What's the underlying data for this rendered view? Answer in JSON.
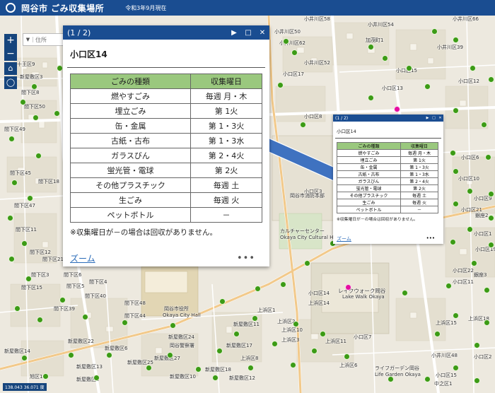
{
  "header": {
    "title": "岡谷市 ごみ収集場所",
    "date": "令和3年9月現在"
  },
  "search": {
    "placeholder": "住所"
  },
  "coords": "138.043 36.071 度",
  "popup": {
    "count": "(1 / 2)",
    "title": "小口区14",
    "columns": [
      "ごみの種類",
      "収集曜日"
    ],
    "rows": [
      [
        "燃やすごみ",
        "毎週 月・木"
      ],
      [
        "埋立ごみ",
        "第 1火"
      ],
      [
        "缶・金属",
        "第 1・3火"
      ],
      [
        "古紙・古布",
        "第 1・3水"
      ],
      [
        "ガラスびん",
        "第 2・4火"
      ],
      [
        "蛍光管・電球",
        "第 2火"
      ],
      [
        "その他プラスチック",
        "毎週 土"
      ],
      [
        "生ごみ",
        "毎週 火"
      ],
      [
        "ペットボトル",
        "－"
      ]
    ],
    "note": "※収集曜日が－の場合は回収がありません。",
    "zoom_label": "ズーム",
    "more_label": "•••"
  },
  "small_popup": {
    "count": "(1 / 2)",
    "title": "小口区14",
    "columns": [
      "ごみの種類",
      "収集曜日"
    ],
    "rows": [
      [
        "燃やすごみ",
        "毎週 月・木"
      ],
      [
        "埋立ごみ",
        "第 1火"
      ],
      [
        "缶・金属",
        "第 1・3火"
      ],
      [
        "古紙・古布",
        "第 1・3水"
      ],
      [
        "ガラスびん",
        "第 2・4火"
      ],
      [
        "蛍光管・電球",
        "第 2火"
      ],
      [
        "その他プラスチック",
        "毎週 土"
      ],
      [
        "生ごみ",
        "毎週 火"
      ],
      [
        "ペットボトル",
        "－"
      ]
    ],
    "note": "※収集曜日が－の場合は回収がありません。",
    "zoom_label": "ズーム",
    "more_label": "•••"
  },
  "map_labels": [
    "加茂町1",
    "小井川区66",
    "小井川区50",
    "小井川区62",
    "小井川区52",
    "小口区15",
    "小口区13",
    "小口区12",
    "小口区17",
    "小口区8",
    "小口区6",
    "小口区10",
    "小口区21",
    "小口区9",
    "小口区1",
    "小口区19",
    "小口区22",
    "小口区11",
    "小口区14",
    "十王区9",
    "新屋敷区3",
    "間下区8",
    "間下区49",
    "間下区45",
    "間下区47",
    "間下区11",
    "間下区3",
    "間下区6",
    "間下区12",
    "間下区4",
    "間下区5",
    "間下区40",
    "間下区39",
    "間下区44",
    "間下区48",
    "新屋敷区14",
    "新屋敷区22",
    "新屋敷区6",
    "新屋敷区24",
    "新屋敷区25",
    "新屋敷区27",
    "新屋敷区10",
    "新屋敷区11",
    "新屋敷区17",
    "新屋敷区13",
    "新屋敷区5",
    "上浜区1",
    "上浜区2",
    "上浜区3",
    "上浜区6",
    "上浜区8",
    "上浜区10",
    "上浜区11",
    "上浜区14",
    "上浜区15",
    "上浜区18",
    "旭区14",
    "中之区1",
    "銀座2",
    "銀座3",
    "間下区50",
    "間下区18",
    "間下区21",
    "小井川区48",
    "新屋敷区18",
    "新屋敷区12",
    "小井川区58",
    "小井川区39",
    "小井川区54",
    "間下区15",
    "小口区7",
    "小口区15",
    "小口区3",
    "小口区2"
  ],
  "map_places": [
    "レイクウォーク岡谷",
    "Lake Walk Okaya",
    "岡谷市役所",
    "Okaya City Hall",
    "カルチャーセンター",
    "Okaya City Cultural Hall",
    "岡谷市消防本部",
    "岡谷警察署",
    "ライフガーデン岡谷",
    "Life Garden Okaya"
  ],
  "colors": {
    "header": "#1a4d91",
    "marker": "#3c9b16",
    "marker_special": "#e60da0",
    "table_header": "#9ac87e",
    "arrow": "#3f72c0"
  }
}
